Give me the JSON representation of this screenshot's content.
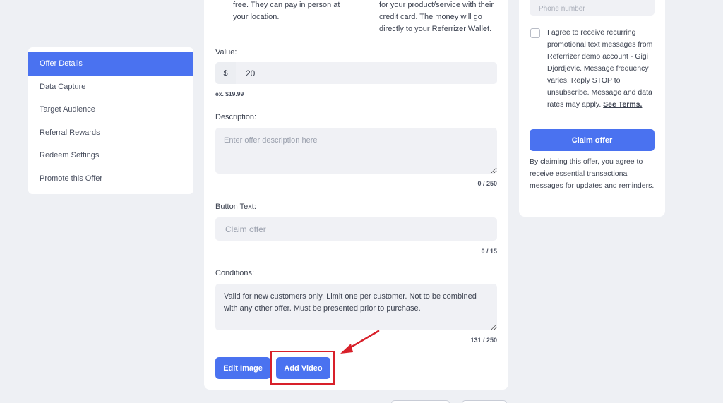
{
  "sidebar": {
    "items": [
      {
        "label": "Offer Details"
      },
      {
        "label": "Data Capture"
      },
      {
        "label": "Target Audience"
      },
      {
        "label": "Referral Rewards"
      },
      {
        "label": "Redeem Settings"
      },
      {
        "label": "Promote this Offer"
      }
    ]
  },
  "form": {
    "top_left_text_1": "free. They can pay in person at",
    "top_left_text_2": "your location.",
    "top_right_text_1": "for your product/service with their",
    "top_right_text_2": "credit card. The money will go",
    "top_right_text_3": "directly to your Referrizer Wallet.",
    "value_label": "Value:",
    "currency_symbol": "$",
    "value": "20",
    "value_hint": "ex. $19.99",
    "description_label": "Description:",
    "description_placeholder": "Enter offer description here",
    "description_counter": "0 / 250",
    "button_text_label": "Button Text:",
    "button_text_placeholder": "Claim offer",
    "button_text_counter": "0 / 15",
    "conditions_label": "Conditions:",
    "conditions_value": "Valid for new customers only. Limit one per customer. Not to be combined with any other offer. Must be presented prior to purchase.",
    "conditions_counter": "131 / 250",
    "edit_image_label": "Edit Image",
    "add_video_label": "Add Video"
  },
  "preview": {
    "phone_placeholder": "Phone number",
    "consent_text": "I agree to receive recurring promotional text messages from Referrizer demo account - Gigi Djordjevic. Message frequency varies. Reply STOP to unsubscribe. Message and data rates may apply. ",
    "terms_link": "See Terms.",
    "claim_button": "Claim offer",
    "claim_note": "By claiming this offer, you agree to receive essential transactional messages for updates and reminders."
  },
  "colors": {
    "accent": "#4a72f0",
    "highlight": "#d8202a"
  }
}
